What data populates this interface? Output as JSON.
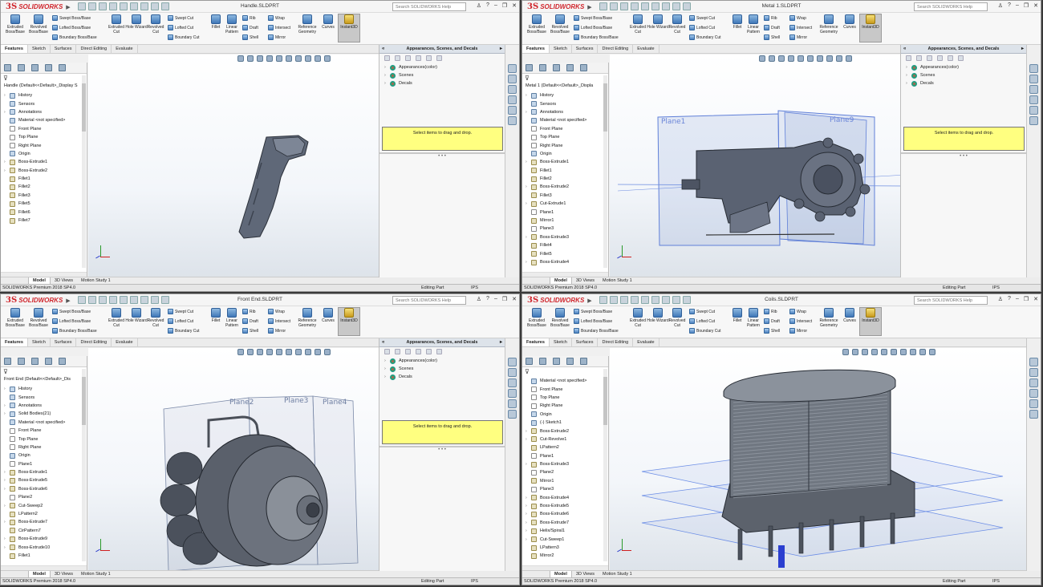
{
  "brand": {
    "ds": "3S",
    "name": "SOLIDWORKS"
  },
  "search_placeholder": "Search SOLIDWORKS Help",
  "ribbon": {
    "extruded_boss": "Extruded Boss/Base",
    "revolved_boss": "Revolved Boss/Base",
    "swept_boss": "Swept Boss/Base",
    "lofted_boss": "Lofted Boss/Base",
    "boundary_boss": "Boundary Boss/Base",
    "extruded_cut": "Extruded Cut",
    "hole_wizard": "Hole Wizard",
    "revolved_cut": "Revolved Cut",
    "swept_cut": "Swept Cut",
    "lofted_cut": "Lofted Cut",
    "boundary_cut": "Boundary Cut",
    "fillet": "Fillet",
    "linear_pattern": "Linear Pattern",
    "rib": "Rib",
    "draft": "Draft",
    "shell": "Shell",
    "wrap": "Wrap",
    "intersect": "Intersect",
    "mirror": "Mirror",
    "reference_geometry": "Reference Geometry",
    "curves": "Curves",
    "instant3d": "Instant3D"
  },
  "cm_tabs": [
    "Features",
    "Sketch",
    "Surfaces",
    "Direct Editing",
    "Evaluate"
  ],
  "bottom_tabs": [
    "Model",
    "3D Views",
    "Motion Study 1"
  ],
  "status": {
    "product": "SOLIDWORKS Premium 2018 SP4.0",
    "editing": "Editing Part",
    "units": "IPS"
  },
  "taskpane": {
    "title": "Appearances, Scenes, and Decals",
    "items": [
      "Appearances(color)",
      "Scenes",
      "Decals"
    ],
    "drop_hint": "Select items to drag and drop."
  },
  "windows": [
    {
      "title": "Handle.SLDPRT",
      "root": "Handle  (Default<<Default>_Display S",
      "tree": [
        "History",
        "Sensors",
        "Annotations",
        "Material <not specified>",
        "Front Plane",
        "Top Plane",
        "Right Plane",
        "Origin",
        "Boss-Extrude1",
        "Boss-Extrude2",
        "Fillet1",
        "Fillet2",
        "Fillet3",
        "Fillet5",
        "Fillet6",
        "Fillet7"
      ]
    },
    {
      "title": "Metal 1.SLDPRT",
      "root": "Metal 1  (Default<<Default>_Displa",
      "tree": [
        "History",
        "Sensors",
        "Annotations",
        "Material <not specified>",
        "Front Plane",
        "Top Plane",
        "Right Plane",
        "Origin",
        "Boss-Extrude1",
        "Fillet1",
        "Fillet2",
        "Boss-Extrude2",
        "Fillet3",
        "Cut-Extrude1",
        "Plane1",
        "Mirror1",
        "Plane3",
        "Boss-Extrude3",
        "Fillet4",
        "Fillet5",
        "Boss-Extrude4"
      ],
      "plane_labels": [
        "Plane1",
        "Plane9"
      ]
    },
    {
      "title": "Front End.SLDPRT",
      "root": "Front End  (Default<<Default>_Dis",
      "tree": [
        "History",
        "Sensors",
        "Annotations",
        "Solid Bodies(21)",
        "Material <not specified>",
        "Front Plane",
        "Top Plane",
        "Right Plane",
        "Origin",
        "Plane1",
        "Boss-Extrude1",
        "Boss-Extrude5",
        "Boss-Extrude6",
        "Plane2",
        "Cut-Sweep2",
        "LPattern2",
        "Boss-Extrude7",
        "CirPattern7",
        "Boss-Extrude9",
        "Boss-Extrude10",
        "Fillet1"
      ],
      "plane_labels": [
        "Plane2",
        "Plane3",
        "Plane4"
      ]
    },
    {
      "title": "Coils.SLDPRT",
      "root": "",
      "tree": [
        "Material <not specified>",
        "Front Plane",
        "Top Plane",
        "Right Plane",
        "Origin",
        "(-) Sketch1",
        "Boss-Extrude2",
        "Cut-Revolve1",
        "LPattern2",
        "Plane1",
        "Boss-Extrude3",
        "Plane2",
        "Mirror1",
        "Plane3",
        "Boss-Extrude4",
        "Boss-Extrude5",
        "Boss-Extrude6",
        "Boss-Extrude7",
        "Helix/Spiral1",
        "Cut-Sweep1",
        "LPattern3",
        "Mirror2"
      ]
    }
  ]
}
